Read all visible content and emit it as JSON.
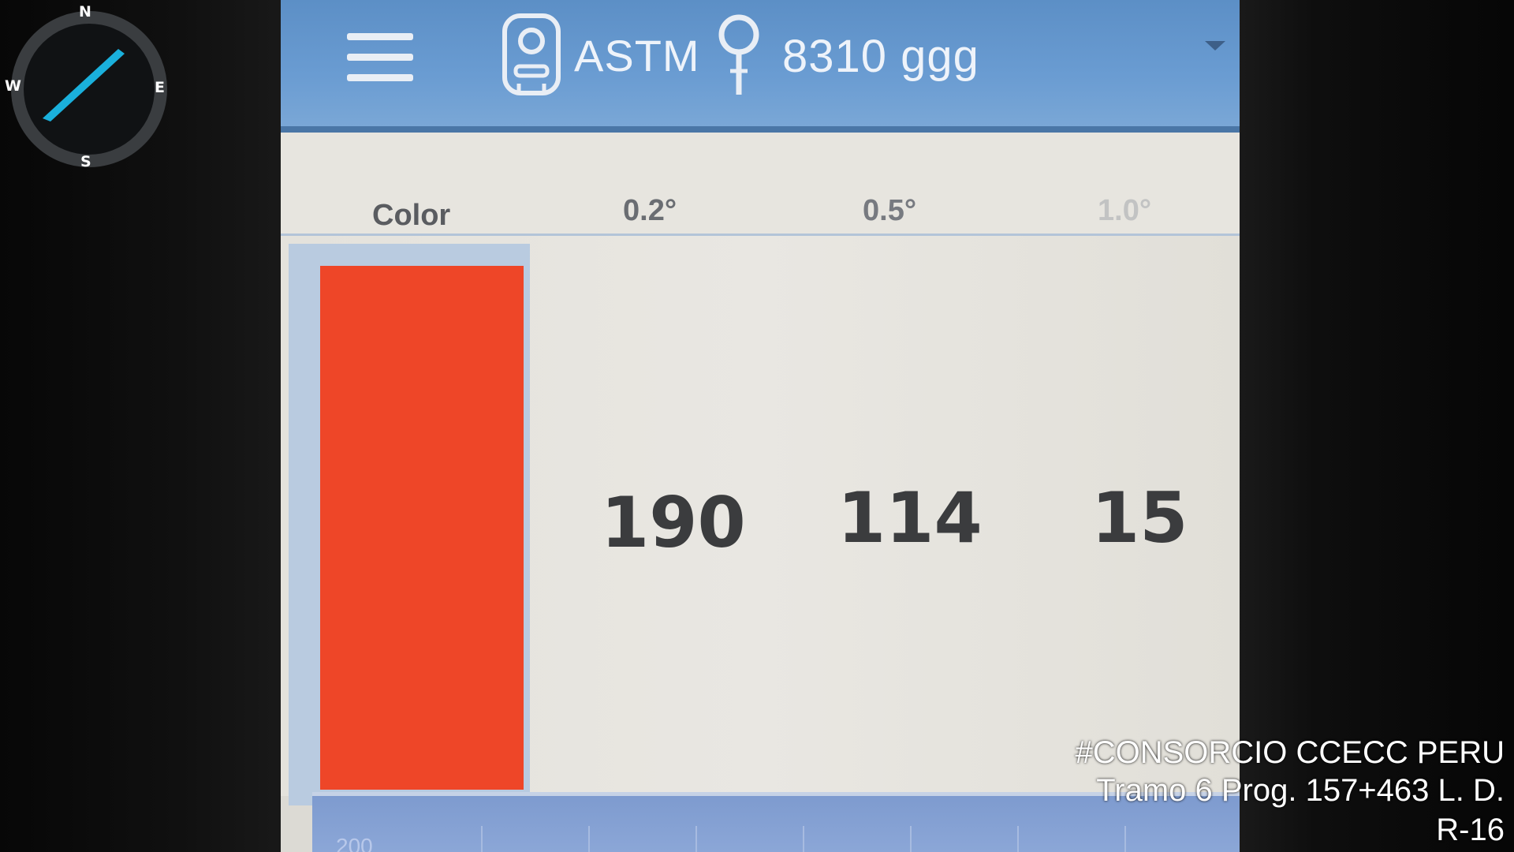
{
  "compass": {
    "north": "N",
    "south": "S",
    "west": "W",
    "east": "E",
    "needle_color": "#1ab0dc"
  },
  "app_bar": {
    "standard": "ASTM",
    "batch": "8310 ggg",
    "background": "#6a9cd2",
    "icons": {
      "menu": "menu-icon",
      "device": "device-icon",
      "location": "pin-icon",
      "dropdown": "chevron-down-icon"
    }
  },
  "table": {
    "headers": [
      "Color",
      "0.2°",
      "0.5°",
      "1.0°"
    ],
    "values": [
      "190",
      "114",
      "15"
    ],
    "swatch_color": "#ee4628"
  },
  "chart_strip": {
    "tick_label": "200"
  },
  "overlay": {
    "line1": "#CONSORCIO CCECC PERU",
    "line2": "Tramo 6 Prog. 157+463 L. D.",
    "line3": "R-16"
  }
}
